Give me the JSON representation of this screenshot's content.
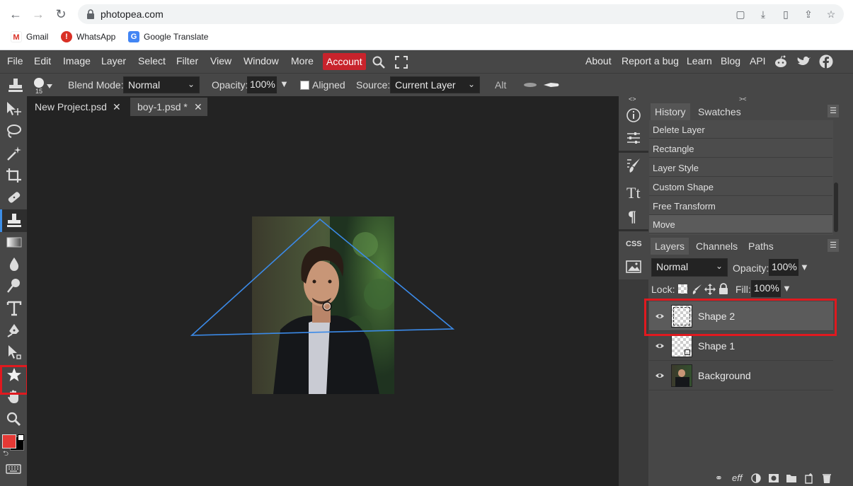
{
  "browser": {
    "url": "photopea.com",
    "bookmarks": [
      "Gmail",
      "WhatsApp",
      "Google Translate"
    ]
  },
  "menubar": {
    "items": [
      "File",
      "Edit",
      "Image",
      "Layer",
      "Select",
      "Filter",
      "View",
      "Window",
      "More"
    ],
    "account": "Account",
    "right_links": [
      "About",
      "Report a bug",
      "Learn",
      "Blog",
      "API"
    ]
  },
  "options": {
    "brush_size": "15",
    "blend_mode_label": "Blend Mode:",
    "blend_mode_value": "Normal",
    "opacity_label": "Opacity:",
    "opacity_value": "100%",
    "aligned_label": "Aligned",
    "source_label": "Source:",
    "source_value": "Current Layer",
    "alt_label": "Alt"
  },
  "tabs": [
    {
      "label": "New Project.psd",
      "active": false
    },
    {
      "label": "boy-1.psd *",
      "active": true
    }
  ],
  "history_panel": {
    "tabs": [
      "History",
      "Swatches"
    ],
    "items": [
      "Delete Layer",
      "Rectangle",
      "Layer Style",
      "Custom Shape",
      "Free Transform",
      "Move"
    ]
  },
  "layers_panel": {
    "tabs": [
      "Layers",
      "Channels",
      "Paths"
    ],
    "blend_mode": "Normal",
    "opacity_label": "Opacity:",
    "opacity_value": "100%",
    "lock_label": "Lock:",
    "fill_label": "Fill:",
    "fill_value": "100%",
    "layers": [
      "Shape 2",
      "Shape 1",
      "Background"
    ],
    "footer_eff": "eff"
  },
  "right_column": {
    "css_label": "CSS"
  },
  "colors": {
    "foreground": "#e53935",
    "background": "#000000",
    "accent": "#3d8ee6",
    "highlight": "#e0191f"
  }
}
